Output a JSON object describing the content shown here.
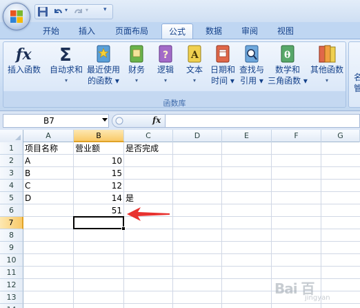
{
  "tabs": [
    {
      "label": "开始"
    },
    {
      "label": "插入"
    },
    {
      "label": "页面布局"
    },
    {
      "label": "公式",
      "active": true
    },
    {
      "label": "数据"
    },
    {
      "label": "审阅"
    },
    {
      "label": "视图"
    }
  ],
  "ribbon": {
    "group_title": "函数库",
    "buttons": [
      {
        "line1": "插入函数",
        "line2": "",
        "icon": "fx-icon"
      },
      {
        "line1": "自动求和",
        "line2": "▾",
        "icon": "sigma-icon"
      },
      {
        "line1": "最近使用",
        "line2": "的函数 ▾",
        "icon": "star-book-icon"
      },
      {
        "line1": "财务",
        "line2": "▾",
        "icon": "finance-book-icon"
      },
      {
        "line1": "逻辑",
        "line2": "▾",
        "icon": "logic-book-icon"
      },
      {
        "line1": "文本",
        "line2": "▾",
        "icon": "text-book-icon"
      },
      {
        "line1": "日期和",
        "line2": "时间 ▾",
        "icon": "date-book-icon"
      },
      {
        "line1": "查找与",
        "line2": "引用 ▾",
        "icon": "lookup-book-icon"
      },
      {
        "line1": "数学和",
        "line2": "三角函数 ▾",
        "icon": "math-book-icon"
      },
      {
        "line1": "其他函数",
        "line2": "▾",
        "icon": "more-books-icon"
      }
    ],
    "partial_label_top": "名",
    "partial_label_bottom": "管"
  },
  "formula_bar": {
    "name_box": "B7",
    "fx": "fx",
    "formula": ""
  },
  "columns": [
    "A",
    "B",
    "C",
    "D",
    "E",
    "F",
    "G"
  ],
  "selected_column": "B",
  "rows": [
    "1",
    "2",
    "3",
    "4",
    "5",
    "6",
    "7",
    "8",
    "9",
    "10",
    "11",
    "12",
    "13",
    "14"
  ],
  "selected_row": "7",
  "cells": {
    "A1": "项目名称",
    "B1": "营业额",
    "C1": "是否完成",
    "A2": "A",
    "B2": "10",
    "A3": "B",
    "B3": "15",
    "A4": "C",
    "B4": "12",
    "A5": "D",
    "B5": "14",
    "C5": "是",
    "B6": "51"
  },
  "watermark": {
    "brand": "Bai 百",
    "sub": "jingyan"
  },
  "colors": {
    "annotation_arrow": "#e8312f",
    "selection": "#f9c968"
  }
}
